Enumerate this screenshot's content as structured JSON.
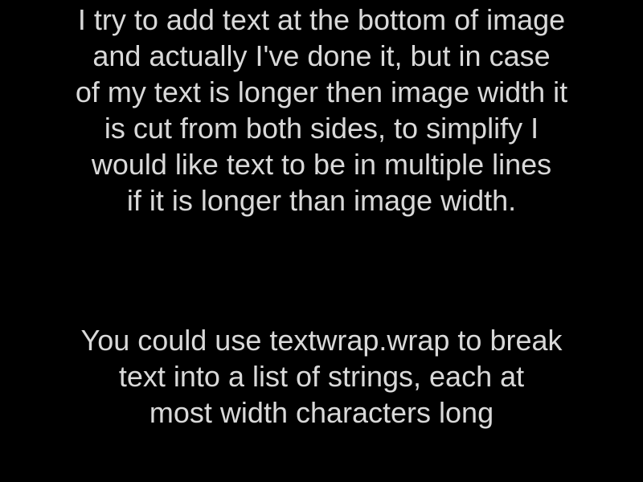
{
  "colors": {
    "background": "#000000",
    "text": "#d9d9d9"
  },
  "question": {
    "lines": [
      "I try to add text at the bottom of image",
      "and actually I've done it, but in case",
      "of my text is longer then image width it",
      "is cut from both sides, to simplify I",
      "would like text to be in multiple lines",
      "if it is longer than image width."
    ]
  },
  "answer": {
    "lines": [
      "You could use textwrap.wrap to break",
      "text into a list of strings, each at",
      "most width characters long"
    ]
  }
}
